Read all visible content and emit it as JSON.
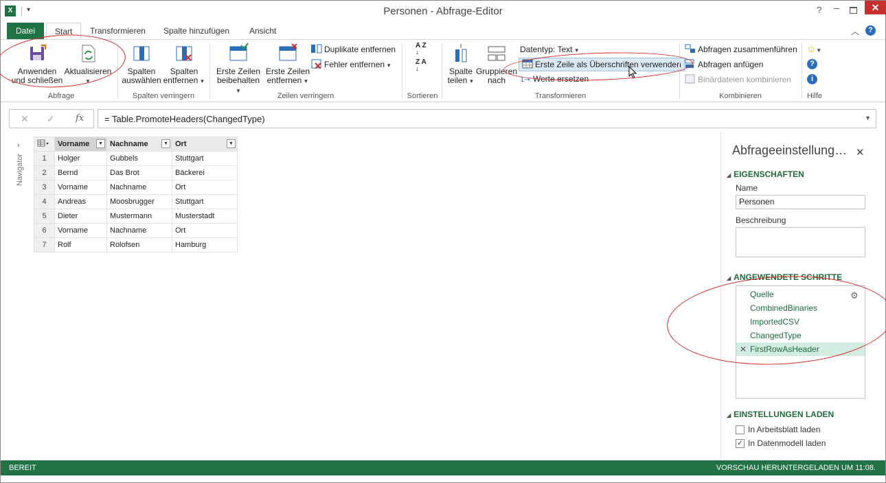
{
  "window": {
    "title": "Personen - Abfrage-Editor",
    "help": "?",
    "minimize": "–",
    "close": "✕"
  },
  "qat": {
    "dropdown": "▾"
  },
  "tabs": {
    "file": "Datei",
    "start": "Start",
    "transform": "Transformieren",
    "add_column": "Spalte hinzufügen",
    "view": "Ansicht"
  },
  "ribbon": {
    "abfrage": {
      "label": "Abfrage",
      "apply_line1": "Anwenden",
      "apply_line2": "und schließen",
      "refresh": "Aktualisieren"
    },
    "spalten": {
      "label": "Spalten verringern",
      "select_line1": "Spalten",
      "select_line2": "auswählen",
      "remove_line1": "Spalten",
      "remove_line2": "entfernen"
    },
    "zeilen": {
      "label": "Zeilen verringern",
      "keep_line1": "Erste Zeilen",
      "keep_line2": "beibehalten",
      "remove_line1": "Erste Zeilen",
      "remove_line2": "entfernen",
      "dup": "Duplikate entfernen",
      "err": "Fehler entfernen"
    },
    "sortieren": {
      "label": "Sortieren",
      "az": "A Z",
      "za": "Z A"
    },
    "transform": {
      "label": "Transformieren",
      "split_line1": "Spalte",
      "split_line2": "teilen",
      "group_line1": "Gruppieren",
      "group_line2": "nach",
      "datatype": "Datentyp: Text",
      "first_row": "Erste Zeile als Überschriften verwenden",
      "replace": "Werte ersetzen"
    },
    "kombinieren": {
      "label": "Kombinieren",
      "merge": "Abfragen zusammenführen",
      "append": "Abfragen anfügen",
      "binaries": "Binärdateien kombinieren"
    },
    "hilfe": {
      "label": "Hilfe"
    }
  },
  "formula": {
    "cancel": "✕",
    "confirm": "✓",
    "fx": "fx",
    "text": "= Table.PromoteHeaders(ChangedType)"
  },
  "navigator": {
    "label": "Navigator"
  },
  "table": {
    "columns": [
      "Vorname",
      "Nachname",
      "Ort"
    ],
    "rows": [
      [
        "1",
        "Holger",
        "Gubbels",
        "Stuttgart"
      ],
      [
        "2",
        "Bernd",
        "Das Brot",
        "Bäckerei"
      ],
      [
        "3",
        "Vorname",
        "Nachname",
        "Ort"
      ],
      [
        "4",
        "Andreas",
        "Moosbrugger",
        "Stuttgart"
      ],
      [
        "5",
        "Dieter",
        "Mustermann",
        "Musterstadt"
      ],
      [
        "6",
        "Vorname",
        "Nachname",
        "Ort"
      ],
      [
        "7",
        "Rolf",
        "Rolofsen",
        "Hamburg"
      ]
    ]
  },
  "pane": {
    "title": "Abfrageeinstellung…",
    "properties": "EIGENSCHAFTEN",
    "name_label": "Name",
    "name_value": "Personen",
    "desc_label": "Beschreibung",
    "steps_header": "ANGEWENDETE SCHRITTE",
    "steps": [
      "Quelle",
      "CombinedBinaries",
      "ImportedCSV",
      "ChangedType",
      "FirstRowAsHeader"
    ],
    "load_header": "EINSTELLUNGEN LADEN",
    "load_sheet": "In Arbeitsblatt laden",
    "load_model": "In Datenmodell laden"
  },
  "status": {
    "left": "BEREIT",
    "right": "VORSCHAU HERUNTERGELADEN UM 11:08."
  },
  "colors": {
    "excel_green": "#217346",
    "step_green": "#1f6a3a",
    "annotation_red": "#d62828",
    "active_step": "#d3ece1"
  }
}
